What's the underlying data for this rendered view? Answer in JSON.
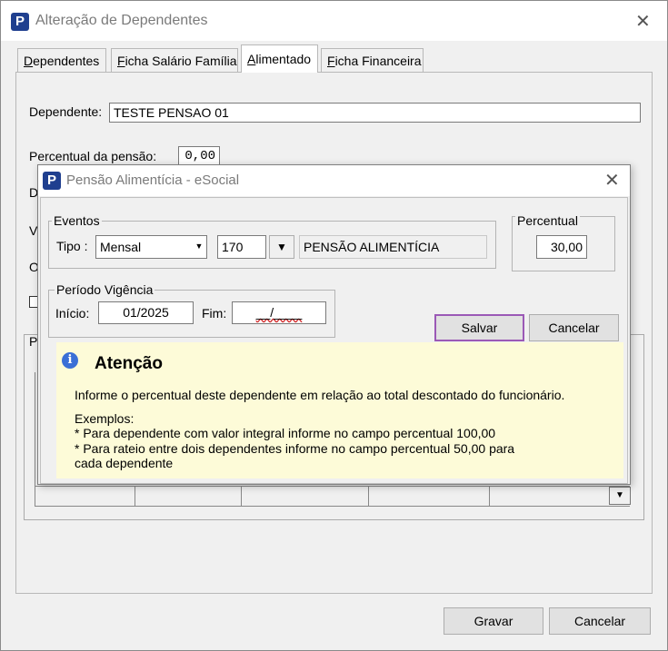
{
  "window": {
    "title": "Alteração de Dependentes",
    "close_glyph": "✕",
    "icon_letter": "P"
  },
  "tabs": [
    {
      "label": "Dependentes",
      "accel": "D",
      "rest": "ependentes"
    },
    {
      "label": "Ficha Salário Família",
      "accel": "F",
      "rest": "icha Salário Família"
    },
    {
      "label": "Alimentado",
      "accel": "A",
      "rest": "limentado"
    },
    {
      "label": "Ficha Financeira",
      "accel": "F",
      "rest": "icha Financeira"
    }
  ],
  "form": {
    "dependente_label": "Dependente:",
    "dependente_value": "TESTE PENSAO 01",
    "percentual_label": "Percentual da pensão:",
    "percentual_value": "0,00",
    "partial_labels": [
      "D",
      "V",
      "O",
      "P"
    ]
  },
  "footer": {
    "gravar_label": "Gravar",
    "cancelar_label": "Cancelar"
  },
  "dialog": {
    "title": "Pensão Alimentícia - eSocial",
    "icon_letter": "P",
    "close_glyph": "✕",
    "eventos": {
      "legend": "Eventos",
      "tipo_label": "Tipo :",
      "tipo_value": "Mensal",
      "codigo_value": "170",
      "descricao_value": "PENSÃO ALIMENTÍCIA"
    },
    "percentual": {
      "legend": "Percentual",
      "value": "30,00"
    },
    "periodo": {
      "legend": "Período Vigência",
      "inicio_label": "Início:",
      "inicio_value": "01/2025",
      "fim_label": "Fim:",
      "fim_value": "__/____"
    },
    "salvar_label": "Salvar",
    "cancelar_label": "Cancelar",
    "help": {
      "title": "Atenção",
      "icon_glyph": "i",
      "line1": "Informe o percentual deste dependente em relação ao total descontado do funcionário.",
      "line2": "Exemplos:",
      "line3": "* Para dependente com valor integral informe no campo percentual 100,00",
      "line4": "* Para rateio entre dois dependentes informe no campo percentual 50,00 para",
      "line5": "cada dependente"
    }
  },
  "colors": {
    "highlight_border": "#9b59b6",
    "help_bg": "#fdfbd8",
    "app_icon_bg": "#1f3f8f"
  }
}
